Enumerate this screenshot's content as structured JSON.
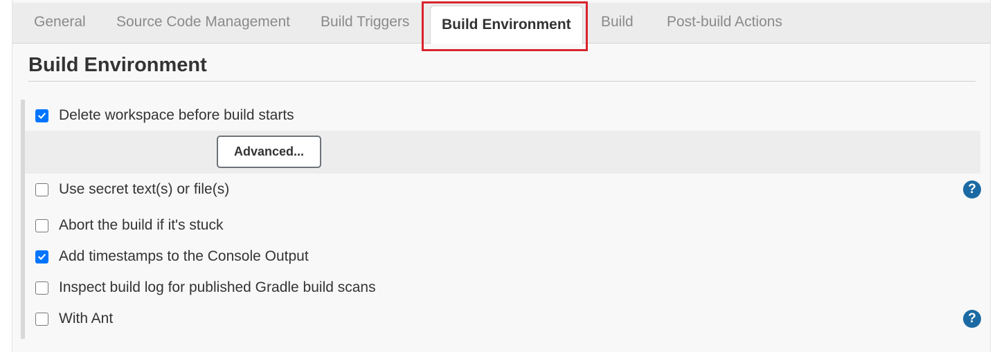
{
  "tabs": [
    {
      "label": "General",
      "active": false
    },
    {
      "label": "Source Code Management",
      "active": false
    },
    {
      "label": "Build Triggers",
      "active": false
    },
    {
      "label": "Build Environment",
      "active": true
    },
    {
      "label": "Build",
      "active": false
    },
    {
      "label": "Post-build Actions",
      "active": false
    }
  ],
  "section": {
    "title": "Build Environment"
  },
  "options": [
    {
      "label": "Delete workspace before build starts",
      "checked": true,
      "help": false
    },
    {
      "label": "Use secret text(s) or file(s)",
      "checked": false,
      "help": true
    },
    {
      "label": "Abort the build if it's stuck",
      "checked": false,
      "help": false
    },
    {
      "label": "Add timestamps to the Console Output",
      "checked": true,
      "help": false
    },
    {
      "label": "Inspect build log for published Gradle build scans",
      "checked": false,
      "help": false
    },
    {
      "label": "With Ant",
      "checked": false,
      "help": true
    }
  ],
  "advanced_button": "Advanced...",
  "help_glyph": "?",
  "colors": {
    "highlight": "#d9232d",
    "checkbox_checked": "#0075ff",
    "help_icon": "#1c6aa3"
  },
  "icons": {
    "checkmark": "checkmark-icon",
    "help": "help-icon"
  }
}
